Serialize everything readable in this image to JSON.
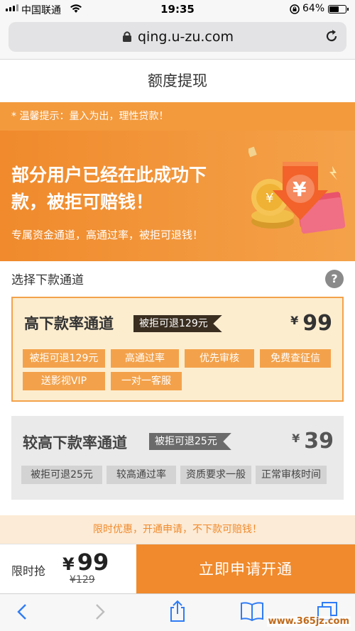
{
  "status_bar": {
    "carrier": "中国联通",
    "time": "19:35",
    "battery": "64%",
    "battery_level": 0.64
  },
  "browser": {
    "url": "qing.u-zu.com"
  },
  "page": {
    "title": "额度提现"
  },
  "tip": {
    "text": "* 温馨提示：量入为出，理性贷款！"
  },
  "banner": {
    "headline": "部分用户已经在此成功下款，被拒可赔钱！",
    "subtext": "专属资金通道，高通过率，被拒可退钱！"
  },
  "channel_select": {
    "label": "选择下款通道",
    "help": "?"
  },
  "channels": [
    {
      "title": "高下款率通道",
      "ribbon": "被拒可退129元",
      "currency": "¥",
      "price": "99",
      "tags": [
        "被拒可退129元",
        "高通过率",
        "优先审核",
        "免费查征信",
        "送影视VIP",
        "一对一客服"
      ]
    },
    {
      "title": "较高下款率通道",
      "ribbon": "被拒可退25元",
      "currency": "¥",
      "price": "39",
      "tags": [
        "被拒可退25元",
        "较高通过率",
        "资质要求一般",
        "正常审核时间"
      ]
    }
  ],
  "promo": {
    "text": "限时优惠，开通申请，不下款可赔钱！"
  },
  "buy_bar": {
    "label": "限时抢",
    "currency": "¥",
    "price": "99",
    "original_price": "¥129",
    "cta": "立即申请开通"
  },
  "watermark": {
    "text": "www.365jz.com"
  },
  "colors": {
    "accent": "#f08a2c",
    "tag_orange": "#f3a24b",
    "card_selected_bg": "#fdedcf",
    "ribbon_dark": "#3a2e20"
  },
  "icons": [
    "signal-icon",
    "wifi-icon",
    "orientation-lock-icon",
    "battery-icon",
    "lock-icon",
    "reload-icon",
    "back-icon",
    "forward-icon",
    "share-icon",
    "bookmarks-icon",
    "tabs-icon",
    "help-icon"
  ]
}
